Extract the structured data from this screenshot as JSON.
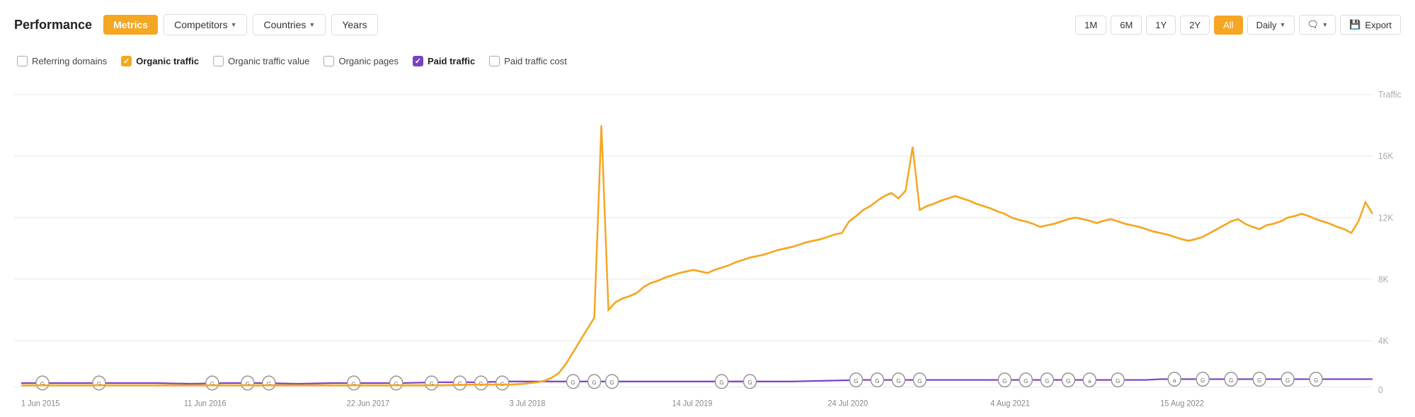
{
  "toolbar": {
    "title": "Performance",
    "metrics_label": "Metrics",
    "competitors_label": "Competitors",
    "countries_label": "Countries",
    "years_label": "Years",
    "time_buttons": [
      "1M",
      "6M",
      "1Y",
      "2Y",
      "All"
    ],
    "active_time": "All",
    "granularity_label": "Daily",
    "annotation_icon": "💬",
    "export_label": "Export"
  },
  "legend": [
    {
      "id": "referring-domains",
      "label": "Referring domains",
      "checked": false,
      "color": "none"
    },
    {
      "id": "organic-traffic",
      "label": "Organic traffic",
      "checked": true,
      "color": "orange"
    },
    {
      "id": "organic-traffic-value",
      "label": "Organic traffic value",
      "checked": false,
      "color": "none"
    },
    {
      "id": "organic-pages",
      "label": "Organic pages",
      "checked": false,
      "color": "none"
    },
    {
      "id": "paid-traffic",
      "label": "Paid traffic",
      "checked": true,
      "color": "purple"
    },
    {
      "id": "paid-traffic-cost",
      "label": "Paid traffic cost",
      "checked": false,
      "color": "none"
    }
  ],
  "chart": {
    "y_labels": [
      "Traffic",
      "16K",
      "12K",
      "8K",
      "4K",
      "0"
    ],
    "x_labels": [
      "1 Jun 2015",
      "11 Jun 2016",
      "22 Jun 2017",
      "3 Jul 2018",
      "14 Jul 2019",
      "24 Jul 2020",
      "4 Aug 2021",
      "15 Aug 2022"
    ]
  }
}
